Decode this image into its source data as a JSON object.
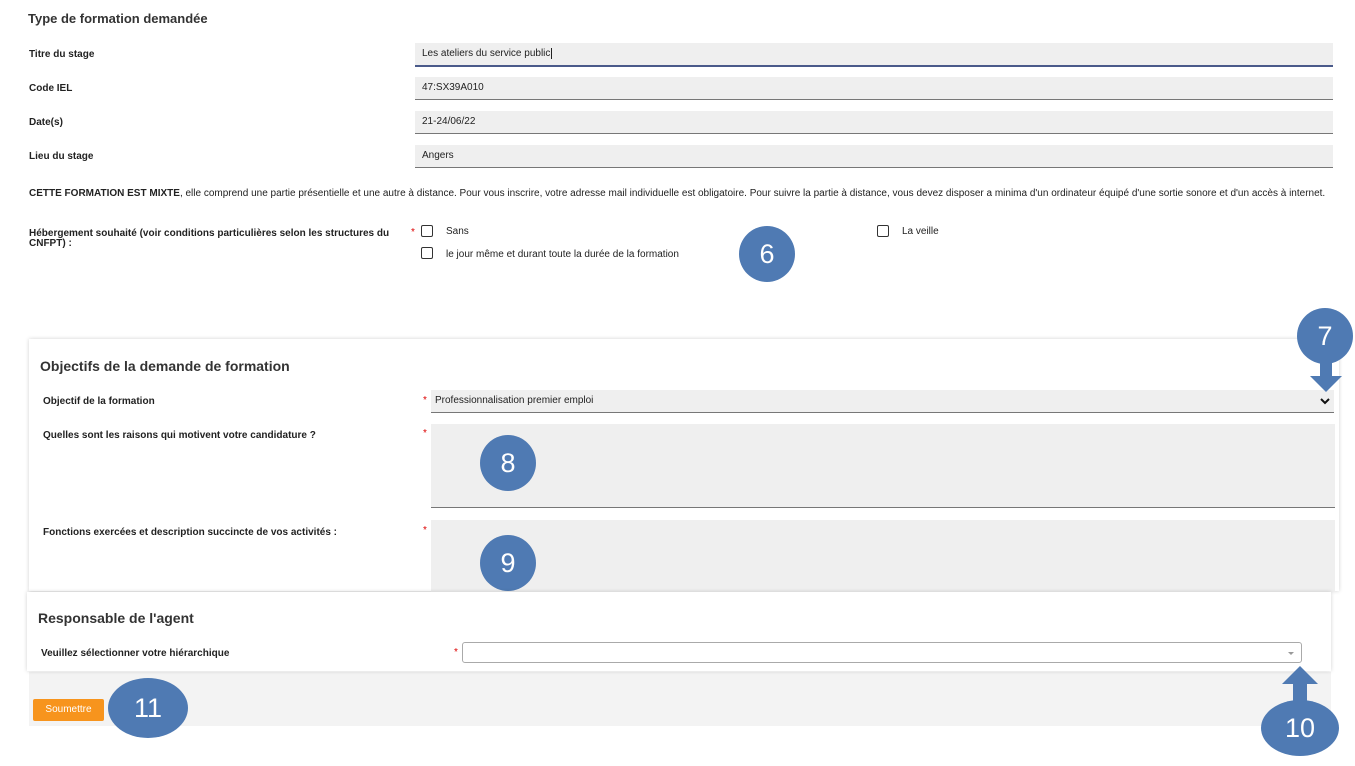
{
  "section1": {
    "title": "Type de formation demandée",
    "fields": [
      {
        "label": "Titre du stage",
        "value": "Les ateliers du service public"
      },
      {
        "label": "Code IEL",
        "value": "47:SX39A010"
      },
      {
        "label": "Date(s)",
        "value": "21-24/06/22"
      },
      {
        "label": "Lieu du stage",
        "value": "Angers"
      }
    ],
    "notice_bold": "CETTE FORMATION EST MIXTE",
    "notice_text": ", elle comprend une partie présentielle et une autre à distance. Pour vous inscrire, votre adresse mail individuelle est obligatoire. Pour suivre la partie à distance, vous devez disposer a minima d'un ordinateur équipé d'une sortie sonore et d'un accès à internet.",
    "hebergement_label": "Hébergement souhaité (voir conditions particulières selon les structures du CNFPT) :",
    "options": {
      "sans": "Sans",
      "veille": "La veille",
      "jour": "le jour même et durant toute la durée de la formation"
    }
  },
  "section2": {
    "title": "Objectifs de la demande de formation",
    "objectif_label": "Objectif de la formation",
    "objectif_value": "Professionnalisation premier emploi",
    "raisons_label": "Quelles sont les raisons qui motivent votre candidature ?",
    "fonctions_label": "Fonctions exercées et description succincte de vos activités :"
  },
  "section3": {
    "title": "Responsable de l'agent",
    "hierarchique_label": "Veuillez sélectionner votre hiérarchique",
    "hierarchique_value": ""
  },
  "submit_label": "Soumettre",
  "required_mark": "*",
  "badges": {
    "b6": "6",
    "b7": "7",
    "b8": "8",
    "b9": "9",
    "b10": "10",
    "b11": "11"
  },
  "colors": {
    "badge": "#4f7ab3",
    "submit": "#f7941d",
    "required": "#dd0000"
  }
}
